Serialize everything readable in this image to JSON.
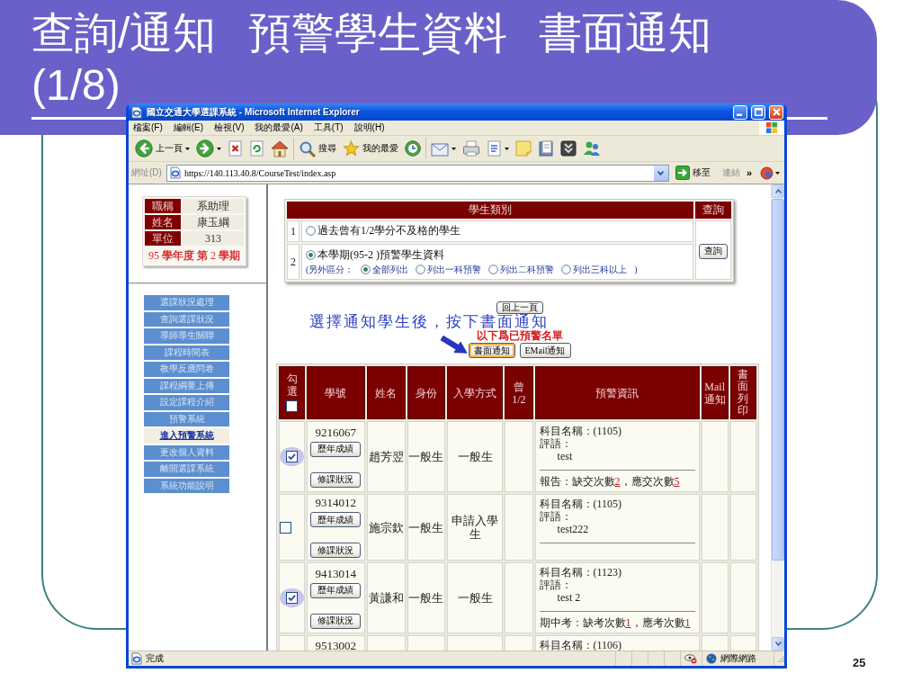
{
  "slide": {
    "title": "查詢/通知 預警學生資料 書面通知 (1/8)",
    "page_number": "25"
  },
  "browser": {
    "title": "國立交通大學選課系統 - Microsoft Internet Explorer",
    "menu": [
      "檔案(F)",
      "編輯(E)",
      "檢視(V)",
      "我的最愛(A)",
      "工具(T)",
      "說明(H)"
    ],
    "toolbar_groups": [
      [
        {
          "kind": "back",
          "label": "上一頁",
          "dropdown": true
        },
        {
          "kind": "forward",
          "dropdown": true
        },
        {
          "kind": "stop",
          "dropdown": false
        },
        {
          "kind": "refresh",
          "dropdown": false
        },
        {
          "kind": "home",
          "dropdown": false
        }
      ],
      [
        {
          "kind": "search",
          "label": "搜尋",
          "dropdown": false
        },
        {
          "kind": "favorites",
          "label": "我的最愛",
          "dropdown": false
        },
        {
          "kind": "history",
          "dropdown": false
        }
      ],
      [
        {
          "kind": "mail",
          "dropdown": true
        },
        {
          "kind": "print",
          "dropdown": false
        },
        {
          "kind": "edit",
          "dropdown": true
        },
        {
          "kind": "notes",
          "dropdown": false
        },
        {
          "kind": "research",
          "dropdown": false
        },
        {
          "kind": "media",
          "dropdown": false
        },
        {
          "kind": "messenger",
          "dropdown": false
        }
      ]
    ],
    "address": {
      "label": "網址(D)",
      "url": "https://140.113.40.8/CourseTest/index.asp",
      "go": "移至",
      "links": "連結",
      "more": "»"
    },
    "status_bar": {
      "text": "完成",
      "zone": "網際網路"
    }
  },
  "sidebar": {
    "info": [
      {
        "label": "職稱",
        "value": "系助理"
      },
      {
        "label": "姓名",
        "value": "康玉綱"
      },
      {
        "label": "單位",
        "value": "313"
      }
    ],
    "term": "95 **學年度 第** 2 **學期**",
    "menu": [
      {
        "label": "選課狀況處理",
        "selected": false
      },
      {
        "label": "查詢選課狀況",
        "selected": false
      },
      {
        "label": "導師導生關聯",
        "selected": false
      },
      {
        "label": "課程時間表",
        "selected": false
      },
      {
        "label": "教學反應問卷",
        "selected": false
      },
      {
        "label": "課程綱要上傳",
        "selected": false
      },
      {
        "label": "設定課程介紹",
        "selected": false
      },
      {
        "label": "預警系統",
        "selected": false
      },
      {
        "label": "進入預警系統",
        "selected": true
      },
      {
        "label": "更改個人資料",
        "selected": false
      },
      {
        "label": "離開選課系統",
        "selected": false
      },
      {
        "label": "系統功能說明",
        "selected": false
      }
    ]
  },
  "query": {
    "columns": [
      "學生類別",
      "查詢"
    ],
    "categories": [
      {
        "number": "1",
        "label": "過去曾有1/2學分不及格的學生",
        "selected": false
      },
      {
        "number": "2",
        "label": "本學期(95-2 )預警學生資料",
        "selected": true,
        "filter": {
          "prefix": "(另外區分：",
          "options": [
            {
              "label": "全部列出",
              "selected": true
            },
            {
              "label": "列出一科預警",
              "selected": false
            },
            {
              "label": "列出二科預警",
              "selected": false
            },
            {
              "label": "列出三科以上",
              "selected": false
            }
          ],
          "suffix": ")"
        }
      }
    ],
    "button": "查詢"
  },
  "back_button": "回上一頁",
  "annotation": "選擇通知學生後，按下書面通知",
  "list_title": "以下爲已預警名單",
  "notify_buttons": [
    {
      "label": "書面通知",
      "focused": true
    },
    {
      "label": "EMail通知",
      "focused": false
    }
  ],
  "table": {
    "columns": [
      {
        "label": "勾選",
        "kind": "select"
      },
      {
        "label": "學號",
        "kind": "text"
      },
      {
        "label": "姓名",
        "kind": "text"
      },
      {
        "label": "身份",
        "kind": "text"
      },
      {
        "label": "入學方式",
        "kind": "text"
      },
      {
        "label": "曾 1/2",
        "kind": "text"
      },
      {
        "label": "預警資訊",
        "kind": "text"
      },
      {
        "label": "Mail 通知",
        "kind": "text"
      },
      {
        "label": "書面列印",
        "kind": "vertical"
      }
    ],
    "select_all": {
      "checked": false
    },
    "rows": [
      {
        "checked": true,
        "student_id": "9216067",
        "buttons": [
          "歷年成績",
          "修課狀況"
        ],
        "name": "趙芳翌",
        "identity": "一般生",
        "admission": "一般生",
        "warning": {
          "course": "科目名稱：(1105)",
          "comment_label": "評語：",
          "comment": "test",
          "report": [
            {
              "kind": "text",
              "text": "報告：缺交次數"
            },
            {
              "kind": "link",
              "text": "2"
            },
            {
              "kind": "text",
              "text": "，應交次數"
            },
            {
              "kind": "link",
              "text": "5"
            }
          ]
        }
      },
      {
        "checked": false,
        "student_id": "9314012",
        "buttons": [
          "歷年成績",
          "修課狀況"
        ],
        "name": "施宗欽",
        "identity": "一般生",
        "admission": "申請入學生",
        "warning": {
          "course": "科目名稱：(1105)",
          "comment_label": "評語：",
          "comment": "test222"
        }
      },
      {
        "checked": true,
        "student_id": "9413014",
        "buttons": [
          "歷年成績",
          "修課狀況"
        ],
        "name": "黃謙和",
        "identity": "一般生",
        "admission": "一般生",
        "warning": {
          "course": "科目名稱：(1123)",
          "comment_label": "評語：",
          "comment": "test 2",
          "report": [
            {
              "kind": "text",
              "text": "期中考：缺考次數"
            },
            {
              "kind": "link",
              "text": "1"
            },
            {
              "kind": "text",
              "text": "，應考次數"
            },
            {
              "kind": "link",
              "text": "1"
            }
          ]
        }
      },
      {
        "student_id": "9513002",
        "warning": {
          "course": "科目名稱：(1106)"
        }
      }
    ]
  }
}
